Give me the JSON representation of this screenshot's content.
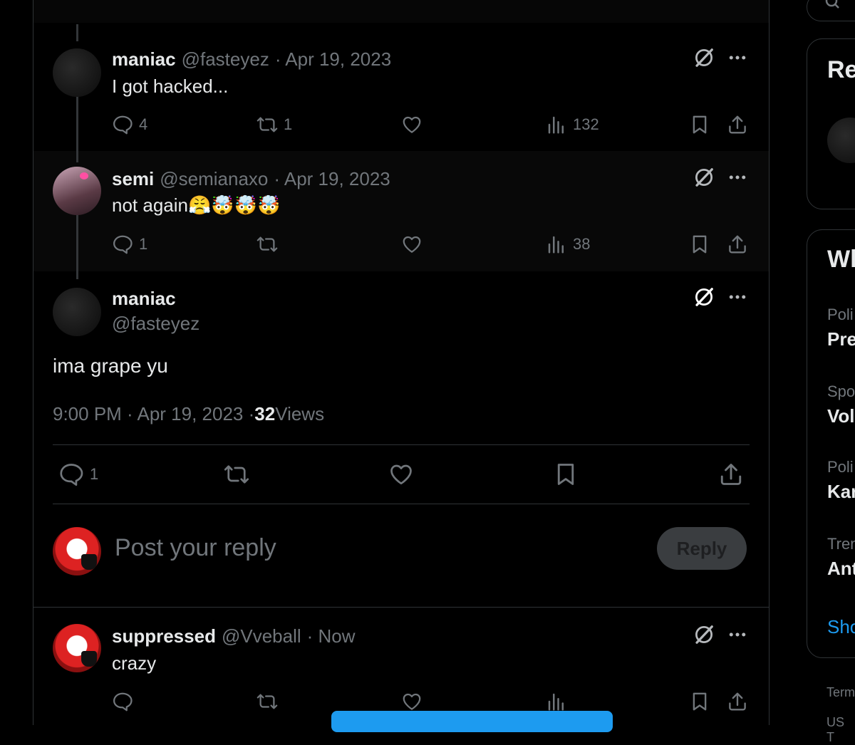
{
  "thread": [
    {
      "name": "maniac",
      "handle": "@fasteyez",
      "date": "· Apr 19, 2023",
      "text": "I got hacked...",
      "replies": "4",
      "reposts": "1",
      "likes": "",
      "views": "132"
    },
    {
      "name": "semi",
      "handle": "@semianaxo",
      "date": "· Apr 19, 2023",
      "text": "not again",
      "emoji": "😤🤯🤯🤯",
      "replies": "1",
      "reposts": "",
      "likes": "",
      "views": "38"
    }
  ],
  "main_post": {
    "name": "maniac",
    "handle": "@fasteyez",
    "text": "ima grape yu",
    "time": "9:00 PM · Apr 19, 2023 · ",
    "views_count": "32",
    "views_label": " Views",
    "replies": "1"
  },
  "composer": {
    "placeholder": "Post your reply",
    "button": "Reply"
  },
  "reply_post": {
    "name": "suppressed",
    "handle": "@Vveball",
    "date": "· Now",
    "text": "crazy"
  },
  "sidebar": {
    "card1_title": "Re",
    "card2_title": "Wh",
    "trends": [
      {
        "category": "Poli",
        "title": "Pre"
      },
      {
        "category": "Spo",
        "title": "Vol"
      },
      {
        "category": "Poli",
        "title": "Kar"
      },
      {
        "category": "Tren",
        "title": "Ant"
      }
    ],
    "show_more": "Sho",
    "footer1": "Term",
    "footer2": "US T"
  },
  "icons": {
    "reply": "reply-icon",
    "repost": "repost-icon",
    "like": "heart-icon",
    "views": "views-icon",
    "bookmark": "bookmark-icon",
    "share": "share-icon",
    "grok": "grok-icon",
    "more": "more-icon"
  },
  "colors": {
    "bg": "#000000",
    "text": "#e7e9ea",
    "muted": "#71767b",
    "border": "#2f3336",
    "accent": "#1d9bf0"
  }
}
